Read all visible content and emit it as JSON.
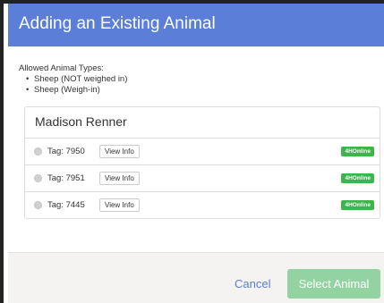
{
  "modal": {
    "title": "Adding an Existing Animal",
    "allowed_label": "Allowed Animal Types:",
    "allowed_types": [
      "Sheep (NOT weighed in)",
      "Sheep (Weigh-in)"
    ],
    "owner_name": "Madison Renner",
    "animals": [
      {
        "tag": "Tag: 7950",
        "view_label": "View Info",
        "badge": "4HOnline",
        "selected": false
      },
      {
        "tag": "Tag: 7951",
        "view_label": "View Info",
        "badge": "4HOnline",
        "selected": false
      },
      {
        "tag": "Tag: 7445",
        "view_label": "View Info",
        "badge": "4HOnline",
        "selected": false
      }
    ],
    "cancel_label": "Cancel",
    "select_label": "Select Animal"
  },
  "colors": {
    "header": "#5b7ed8",
    "badge": "#3db54a",
    "select_button_disabled": "#93d3a2"
  }
}
